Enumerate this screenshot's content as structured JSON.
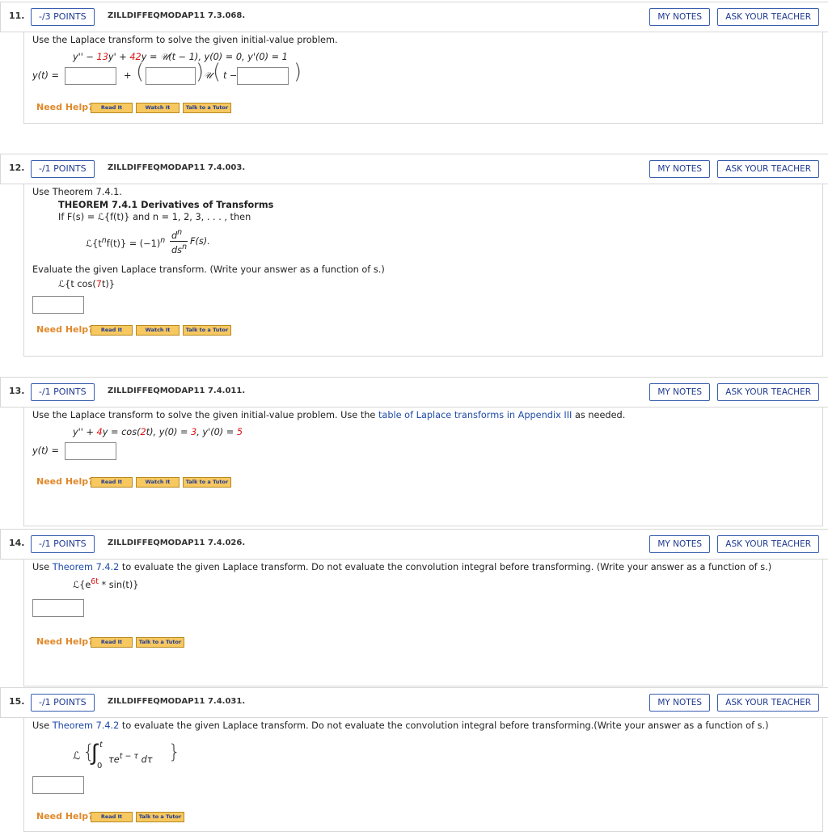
{
  "common": {
    "my_notes": "MY NOTES",
    "ask_teacher": "ASK YOUR TEACHER",
    "need_help": "Need Help?",
    "read_it": "Read It",
    "watch_it": "Watch It",
    "talk_tutor": "Talk to a Tutor"
  },
  "q11": {
    "number": "11.",
    "points": "-/3 POINTS",
    "id": "ZILLDIFFEQMODAP11 7.3.068.",
    "prompt": "Use the Laplace transform to solve the given initial-value problem.",
    "eq_a": "y'' − ",
    "eq_b": "13",
    "eq_c": "y' + ",
    "eq_d": "42",
    "eq_e": "y = 𝒰(t − 1),   y(0) = 0, y'(0) = 1",
    "answer_label": "y(t) =",
    "plus": "+",
    "unit_step": "𝒰",
    "t_minus": "t −"
  },
  "q12": {
    "number": "12.",
    "points": "-/1 POINTS",
    "id": "ZILLDIFFEQMODAP11 7.4.003.",
    "use_theorem": "Use Theorem 7.4.1.",
    "theorem_title": "THEOREM 7.4.1  Derivatives of Transforms",
    "theorem_if": "If F(s) = ℒ{f(t)} and n = 1, 2, 3, . . . , then",
    "formula_lhs": "ℒ{t",
    "formula_n1": "n",
    "formula_mid": "f(t)} = (−1)",
    "formula_n2": "n",
    "formula_d_num": "d",
    "formula_n3": "n",
    "formula_ds": "ds",
    "formula_n4": "n",
    "formula_rhs": "F(s).",
    "evaluate": "Evaluate the given Laplace transform. (Write your answer as a function of s.)",
    "expr_a": "ℒ{t cos(",
    "expr_b": "7",
    "expr_c": "t)}"
  },
  "q13": {
    "number": "13.",
    "points": "-/1 POINTS",
    "id": "ZILLDIFFEQMODAP11 7.4.011.",
    "prompt_a": "Use the Laplace transform to solve the given initial-value problem. Use the ",
    "prompt_link": "table of Laplace transforms in Appendix III",
    "prompt_b": " as needed.",
    "eq_a": "y'' + ",
    "eq_b": "4",
    "eq_c": "y = cos(",
    "eq_d": "2",
    "eq_e": "t),   y(0) = ",
    "eq_f": "3",
    "eq_g": ",   y'(0) = ",
    "eq_h": "5",
    "answer_label": "y(t) ="
  },
  "q14": {
    "number": "14.",
    "points": "-/1 POINTS",
    "id": "ZILLDIFFEQMODAP11 7.4.026.",
    "prompt_a": "Use ",
    "prompt_link": "Theorem 7.4.2",
    "prompt_b": " to evaluate the given Laplace transform. Do not evaluate the convolution integral before transforming. (Write your answer as a function of s.)",
    "expr_a": "ℒ{e",
    "expr_sup": "6t",
    "expr_b": " * sin(t)}"
  },
  "q15": {
    "number": "15.",
    "points": "-/1 POINTS",
    "id": "ZILLDIFFEQMODAP11 7.4.031.",
    "prompt_a": "Use ",
    "prompt_link": "Theorem 7.4.2",
    "prompt_b": " to evaluate the given Laplace transform. Do not evaluate the convolution integral before transforming.(Write your answer as a function of s.)",
    "expr_L": "ℒ",
    "expr_upper": "t",
    "expr_lower": "0",
    "expr_body": "τe",
    "expr_sup": "t − τ",
    "expr_d": "dτ"
  }
}
